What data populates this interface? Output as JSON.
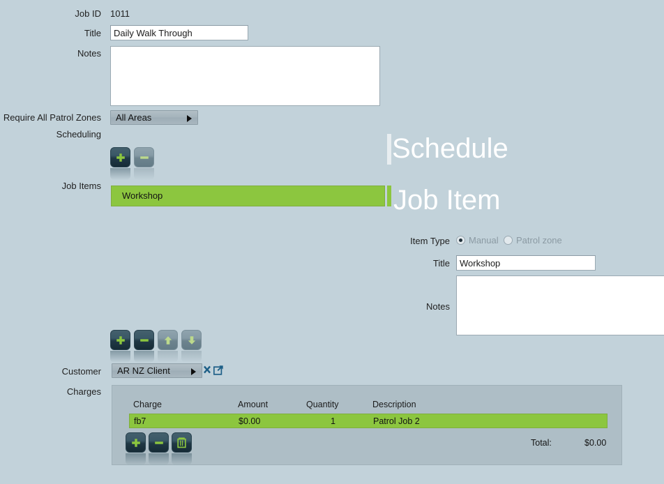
{
  "form": {
    "job_id_label": "Job ID",
    "job_id_value": "1011",
    "title_label": "Title",
    "title_value": "Daily Walk Through",
    "notes_label": "Notes",
    "notes_value": "",
    "patrol_zones_label": "Require All Patrol Zones",
    "patrol_zones_value": "All Areas",
    "scheduling_label": "Scheduling",
    "job_items_label": "Job Items",
    "customer_label": "Customer",
    "customer_value": "AR NZ Client",
    "charges_label": "Charges"
  },
  "headings": {
    "schedule": "Schedule",
    "job_item": "Job Item",
    "schedule_bar_color": "#e8eef1",
    "job_item_bar_color": "#8cc63f"
  },
  "job_items": [
    {
      "label": "Workshop",
      "selected": true
    }
  ],
  "scheduling_buttons": [
    {
      "name": "add-schedule-button",
      "icon": "plus-icon",
      "enabled": true
    },
    {
      "name": "remove-schedule-button",
      "icon": "minus-icon",
      "enabled": false
    }
  ],
  "job_item_buttons": [
    {
      "name": "add-job-item-button",
      "icon": "plus-icon",
      "enabled": true
    },
    {
      "name": "remove-job-item-button",
      "icon": "minus-icon",
      "enabled": true
    },
    {
      "name": "move-job-item-up-button",
      "icon": "arrow-up-icon",
      "enabled": false
    },
    {
      "name": "move-job-item-down-button",
      "icon": "arrow-down-icon",
      "enabled": false
    }
  ],
  "charge_buttons": [
    {
      "name": "add-charge-button",
      "icon": "plus-icon",
      "enabled": true
    },
    {
      "name": "remove-charge-button",
      "icon": "minus-icon",
      "enabled": true
    },
    {
      "name": "delete-charge-button",
      "icon": "trash-icon",
      "enabled": true
    }
  ],
  "customer_actions": [
    {
      "name": "clear-customer-button",
      "icon": "close-x-icon"
    },
    {
      "name": "open-customer-button",
      "icon": "external-link-icon"
    }
  ],
  "detail": {
    "item_type_label": "Item Type",
    "item_type_options": [
      {
        "label": "Manual",
        "selected": true,
        "disabled": true
      },
      {
        "label": "Patrol zone",
        "selected": false,
        "disabled": true
      }
    ],
    "title_label": "Title",
    "title_value": "Workshop",
    "notes_label": "Notes",
    "notes_value": ""
  },
  "charges_table": {
    "columns": [
      "Charge",
      "Amount",
      "Quantity",
      "Description"
    ],
    "rows": [
      {
        "charge": "fb7",
        "amount": "$0.00",
        "quantity": "1",
        "description": "Patrol Job 2",
        "selected": true
      }
    ],
    "total_label": "Total:",
    "total_value": "$0.00"
  },
  "colors": {
    "background": "#c2d2da",
    "panel": "#aebec6",
    "accent_green": "#8cc63f",
    "button_dark": "#203845",
    "field_white": "#ffffff"
  }
}
